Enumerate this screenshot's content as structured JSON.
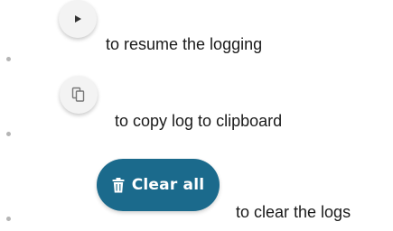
{
  "items": [
    {
      "icon": "play-icon",
      "text": "to resume the logging"
    },
    {
      "icon": "copy-icon",
      "text": "to copy log to clipboard"
    },
    {
      "icon": "trash-icon",
      "button_label": "Clear all",
      "text": "to clear the logs"
    }
  ],
  "colors": {
    "clear_button_bg": "#1b6a8c",
    "round_button_bg": "#f3f3f3",
    "bullet": "#b5b5b5",
    "icon_grey": "#777777"
  }
}
